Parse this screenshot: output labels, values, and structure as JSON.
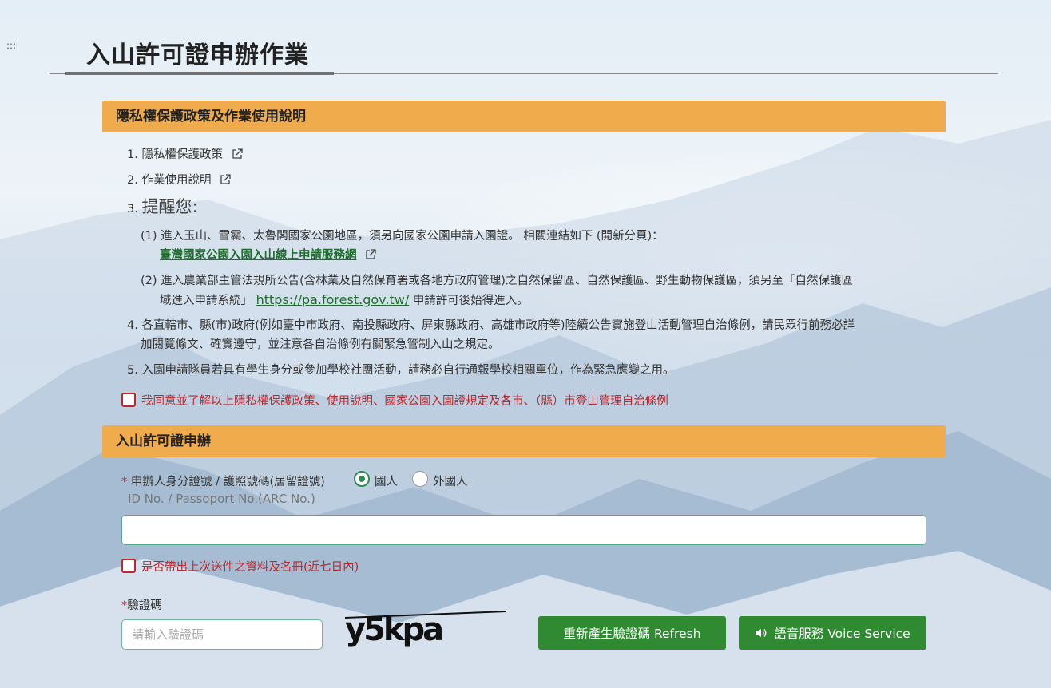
{
  "page": {
    "title": "入山許可證申辦作業",
    "corner_glyph": ":::"
  },
  "privacy_section": {
    "header": "隱私權保護政策及作業使用說明",
    "item1_num": "1.",
    "item1_label": "隱私權保護政策",
    "item2_num": "2.",
    "item2_label": "作業使用說明",
    "item3_num": "3.",
    "item3_label": "提醒您:",
    "sub1_num": "(1)",
    "sub1_text": "進入玉山、雪霸、太魯閣國家公園地區，須另向國家公園申請入園證。 相關連結如下 (開新分頁)：",
    "sub1_link": "臺灣國家公園入園入山線上申請服務網",
    "sub2_num": "(2)",
    "sub2_line1": "進入農業部主管法規所公告(含林業及自然保育署或各地方政府管理)之自然保留區、自然保護區、野生動物保護區，須另至「自然保護區",
    "sub2_line2_pre": "域進入申請系統」",
    "sub2_link": "https://pa.forest.gov.tw/",
    "sub2_line2_post": "申請許可後始得進入。",
    "item4_num": "4.",
    "item4_line1": "各直轄市、縣(市)政府(例如臺中市政府、南投縣政府、屏東縣政府、高雄市政府等)陸續公告實施登山活動管理自治條例，請民眾行前務必詳",
    "item4_line2": "加閱覽條文、確實遵守，並注意各自治條例有關緊急管制入山之規定。",
    "item5_num": "5.",
    "item5_text": "入園申請隊員若具有學生身分或參加學校社團活動，請務必自行通報學校相關單位，作為緊急應變之用。",
    "agree_label": "我同意並了解以上隱私權保護政策、使用說明、國家公園入園證規定及各市、（縣）市登山管理自治條例"
  },
  "permit_section": {
    "header": "入山許可證申辦",
    "required_mark": "*",
    "id_label": "申辦人身分證號 / 護照號碼(居留證號)",
    "radio_citizen": "國人",
    "radio_foreigner": "外國人",
    "id_label_en": "ID No. / Passoport No.(ARC No.)",
    "id_value": "",
    "bring_last_label": "是否帶出上次送件之資料及名冊(近七日內)",
    "captcha_label": "驗證碼",
    "captcha_placeholder": "請輸入驗證碼",
    "captcha_text": "y5kpa",
    "refresh_button": "重新產生驗證碼  Refresh",
    "voice_button": "語音服務 Voice Service"
  },
  "colors": {
    "section_header": "#f0ab4d",
    "button_green": "#2f8a31",
    "link_green": "#1f6e2d",
    "required_red": "#c0272d"
  }
}
